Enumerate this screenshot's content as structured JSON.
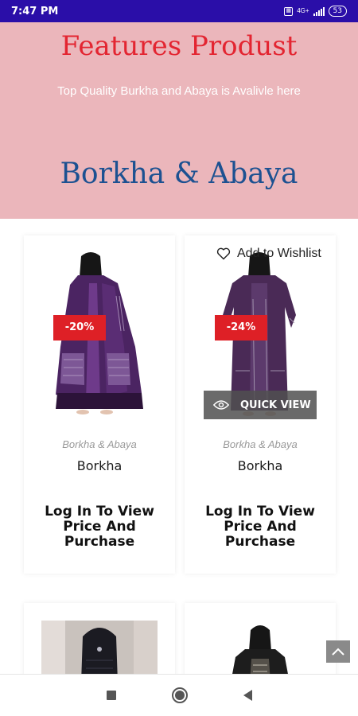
{
  "status_bar": {
    "time": "7:47 PM",
    "network": "4G+",
    "battery": "53"
  },
  "banner": {
    "title": "Features Produst",
    "subtitle": "Top Quality Burkha and Abaya is Avalivle here",
    "category_heading": "Borkha & Abaya",
    "colors": {
      "background": "#ebb6bb",
      "title": "#e32531",
      "heading": "#1c5191"
    }
  },
  "products": [
    {
      "discount": "-20%",
      "category": "Borkha & Abaya",
      "name": "Borkha",
      "cta": "Log In To View Price And Purchase"
    },
    {
      "discount": "-24%",
      "category": "Borkha & Abaya",
      "name": "Borkha",
      "cta": "Log In To View Price And Purchase",
      "wishlist_label": "Add to Wishlist",
      "quick_view_label": "QUICK VIEW"
    }
  ],
  "accent_colors": {
    "status_bar": "#2a0ea8",
    "badge": "#de2026"
  },
  "icons": [
    "heart-icon",
    "eye-icon",
    "chevron-up-icon",
    "nav-recents-icon",
    "nav-home-icon",
    "nav-back-icon"
  ]
}
